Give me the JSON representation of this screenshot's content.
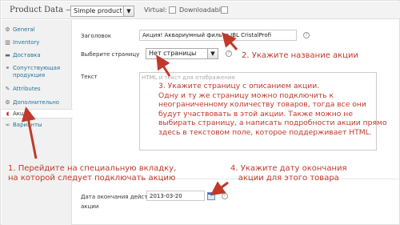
{
  "header": {
    "title": "Product Data —",
    "product_type": "Simple product",
    "virtual_label": "Virtual:",
    "downloadable_label": "Downloadable:"
  },
  "sidebar": {
    "items": [
      {
        "label": "General",
        "icon": "wrench-icon",
        "glyph": "⚙"
      },
      {
        "label": "Inventory",
        "icon": "inventory-icon",
        "glyph": "▥"
      },
      {
        "label": "Доставка",
        "icon": "truck-icon",
        "glyph": "▬"
      },
      {
        "label": "Сопутствующая продукция",
        "icon": "link-icon",
        "glyph": "⚭"
      },
      {
        "label": "Attributes",
        "icon": "pen-icon",
        "glyph": "✎"
      },
      {
        "label": "Дополнительно",
        "icon": "gear-icon",
        "glyph": "⚙"
      },
      {
        "label": "Акция",
        "icon": "tag-icon",
        "glyph": "◖"
      },
      {
        "label": "Варианты",
        "icon": "variations-icon",
        "glyph": "∞"
      }
    ]
  },
  "form": {
    "heading_label": "Заголовок",
    "heading_value": "Акция! Аквариумный фильтр  JBL CristalProfi",
    "page_label": "Выберите страницу",
    "page_value": "Нет страницы",
    "text_label": "Текст",
    "text_placeholder": "HTML и текст для отображения",
    "end_date_label": "Дата окончания действия",
    "end_date_label_2": "акции",
    "end_date_value": "2013-03-20",
    "help_glyph": "?"
  },
  "notes": {
    "n1_line1": "1. Перейдите на специальную вкладку,",
    "n1_line2": "на которой следует подключать акцию",
    "n2": "2. Укажите название акции",
    "n3": [
      "3. Укажите страницу с описанием акции.",
      "Одну и ту же страницу можно подключить к",
      "неограниченному количеству товаров, тогда все они",
      "будут участвовать в этой акции. Также можно не",
      "выбирать страницу, а написать подробности акции прямо",
      "здесь в текстовом поле, которое поддерживает HTML."
    ],
    "n4_line1": "4. Укажите дату окончания",
    "n4_line2": "акции для этого товара"
  },
  "colors": {
    "annotation": "#c0392b",
    "link": "#21759b"
  }
}
